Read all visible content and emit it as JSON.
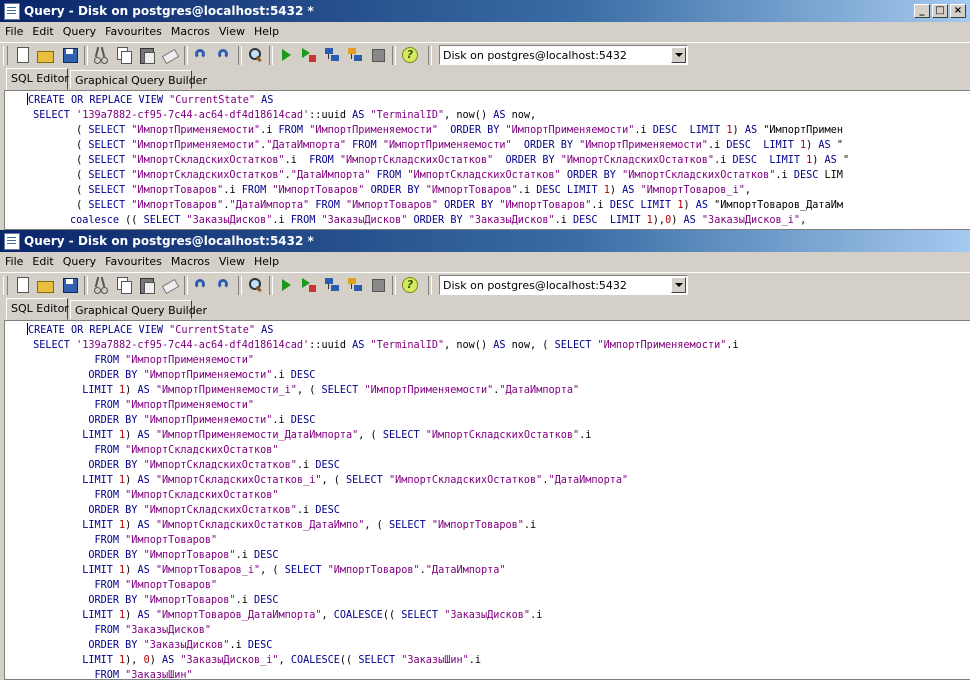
{
  "windows": [
    {
      "title": "Query - Disk on postgres@localhost:5432 *",
      "menu": [
        "File",
        "Edit",
        "Query",
        "Favourites",
        "Macros",
        "View",
        "Help"
      ],
      "connection": "Disk on postgres@localhost:5432",
      "tabs": [
        "SQL Editor",
        "Graphical Query Builder"
      ],
      "code": [
        "CREATE OR REPLACE VIEW \"CurrentState\" AS",
        " SELECT '139a7882-cf95-7c44-ac64-df4d18614cad'::uuid AS \"TerminalID\", now() AS now,",
        "        ( SELECT \"ИмпортПрименяемости\".i FROM \"ИмпортПрименяемости\"  ORDER BY \"ИмпортПрименяемости\".i DESC  LIMIT 1) AS \"ИмпортПримен",
        "        ( SELECT \"ИмпортПрименяемости\".\"ДатаИмпорта\" FROM \"ИмпортПрименяемости\"  ORDER BY \"ИмпортПрименяемости\".i DESC  LIMIT 1) AS \"",
        "        ( SELECT \"ИмпортСкладскихОстатков\".i  FROM \"ИмпортСкладскихОстатков\"  ORDER BY \"ИмпортСкладскихОстатков\".i DESC  LIMIT 1) AS \"",
        "        ( SELECT \"ИмпортСкладскихОстатков\".\"ДатаИмпорта\" FROM \"ИмпортСкладскихОстатков\" ORDER BY \"ИмпортСкладскихОстатков\".i DESC LIM",
        "        ( SELECT \"ИмпортТоваров\".i FROM \"ИмпортТоваров\" ORDER BY \"ИмпортТоваров\".i DESC LIMIT 1) AS \"ИмпортТоваров_i\",",
        "        ( SELECT \"ИмпортТоваров\".\"ДатаИмпорта\" FROM \"ИмпортТоваров\" ORDER BY \"ИмпортТоваров\".i DESC LIMIT 1) AS \"ИмпортТоваров_ДатаИм",
        "       coalesce (( SELECT \"ЗаказыДисков\".i FROM \"ЗаказыДисков\" ORDER BY \"ЗаказыДисков\".i DESC  LIMIT 1),0) AS \"ЗаказыДисков_i\","
      ]
    },
    {
      "title": "Query - Disk on postgres@localhost:5432 *",
      "menu": [
        "File",
        "Edit",
        "Query",
        "Favourites",
        "Macros",
        "View",
        "Help"
      ],
      "connection": "Disk on postgres@localhost:5432",
      "tabs": [
        "SQL Editor",
        "Graphical Query Builder"
      ],
      "code": [
        "CREATE OR REPLACE VIEW \"CurrentState\" AS",
        " SELECT '139a7882-cf95-7c44-ac64-df4d18614cad'::uuid AS \"TerminalID\", now() AS now, ( SELECT \"ИмпортПрименяемости\".i",
        "           FROM \"ИмпортПрименяемости\"",
        "          ORDER BY \"ИмпортПрименяемости\".i DESC",
        "         LIMIT 1) AS \"ИмпортПрименяемости_i\", ( SELECT \"ИмпортПрименяемости\".\"ДатаИмпорта\"",
        "           FROM \"ИмпортПрименяемости\"",
        "          ORDER BY \"ИмпортПрименяемости\".i DESC",
        "         LIMIT 1) AS \"ИмпортПрименяемости_ДатаИмпорта\", ( SELECT \"ИмпортСкладскихОстатков\".i",
        "           FROM \"ИмпортСкладскихОстатков\"",
        "          ORDER BY \"ИмпортСкладскихОстатков\".i DESC",
        "         LIMIT 1) AS \"ИмпортСкладскихОстатков_i\", ( SELECT \"ИмпортСкладскихОстатков\".\"ДатаИмпорта\"",
        "           FROM \"ИмпортСкладскихОстатков\"",
        "          ORDER BY \"ИмпортСкладскихОстатков\".i DESC",
        "         LIMIT 1) AS \"ИмпортСкладскихОстатков_ДатаИмпо\", ( SELECT \"ИмпортТоваров\".i",
        "           FROM \"ИмпортТоваров\"",
        "          ORDER BY \"ИмпортТоваров\".i DESC",
        "         LIMIT 1) AS \"ИмпортТоваров_i\", ( SELECT \"ИмпортТоваров\".\"ДатаИмпорта\"",
        "           FROM \"ИмпортТоваров\"",
        "          ORDER BY \"ИмпортТоваров\".i DESC",
        "         LIMIT 1) AS \"ИмпортТоваров_ДатаИмпорта\", COALESCE(( SELECT \"ЗаказыДисков\".i",
        "           FROM \"ЗаказыДисков\"",
        "          ORDER BY \"ЗаказыДисков\".i DESC",
        "         LIMIT 1), 0) AS \"ЗаказыДисков_i\", COALESCE(( SELECT \"ЗаказыШин\".i",
        "           FROM \"ЗаказыШин\""
      ]
    }
  ],
  "toolbar_icons": [
    "new-file-icon",
    "open-folder-icon",
    "save-icon",
    "cut-icon",
    "copy-icon",
    "paste-icon",
    "clear-icon",
    "undo-icon",
    "redo-icon",
    "find-icon",
    "execute-icon",
    "execute-to-file-icon",
    "explain-icon",
    "explain-analyze-icon",
    "cancel-query-icon",
    "help-icon"
  ],
  "colors": {
    "keyword": "#00008b",
    "string": "#800080",
    "number": "#b00000",
    "title_start": "#0a246a",
    "title_end": "#a6caf0",
    "chrome": "#d4d0c8"
  }
}
